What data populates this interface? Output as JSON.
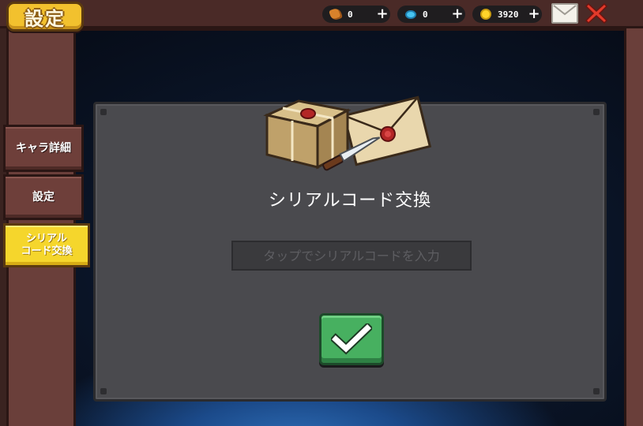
{
  "header": {
    "title": "設定",
    "currencies": [
      {
        "icon": "seed-icon",
        "value": "0",
        "color": "#d9822b"
      },
      {
        "icon": "gem-icon",
        "value": "0",
        "color": "#47c4f0"
      },
      {
        "icon": "coin-icon",
        "value": "3920",
        "color": "#ffd42a"
      }
    ],
    "plus_label": "+",
    "mail_icon": "mail-icon",
    "close_icon": "close-icon"
  },
  "sidebar": {
    "tabs": [
      {
        "label": "キャラ詳細",
        "active": false
      },
      {
        "label": "設定",
        "active": false
      },
      {
        "label": "シリアル\nコード交換",
        "active": true
      }
    ]
  },
  "panel": {
    "title": "シリアルコード交換",
    "input": {
      "value": "",
      "placeholder": "タップでシリアルコードを入力"
    },
    "confirm_icon": "checkmark-icon",
    "illustration": "parcel-and-letter-icon"
  },
  "colors": {
    "accent_yellow": "#f5d62c",
    "confirm_green": "#47b060",
    "close_red": "#e23a2a",
    "panel_gray": "#4a4a4e"
  }
}
